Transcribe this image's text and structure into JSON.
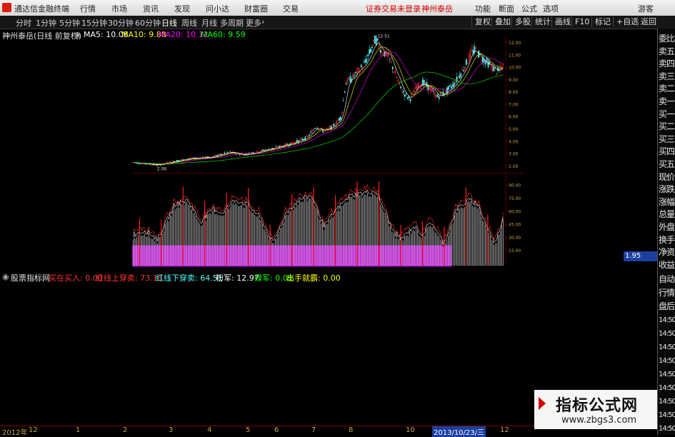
{
  "menubar": {
    "app_name": "通达信金融终端",
    "items": [
      "行情",
      "市场",
      "资讯",
      "发现",
      "问小达",
      "财富圈",
      "交易"
    ],
    "warning": "证券交易未登录",
    "stock_tag": "神州泰岳",
    "right_items": [
      "功能",
      "断面",
      "公式",
      "选项"
    ],
    "guest": "游客"
  },
  "toolbar": {
    "periods": [
      "分时",
      "1分钟",
      "5分钟",
      "15分钟",
      "30分钟",
      "60分钟",
      "日线",
      "周线",
      "月线",
      "多周期",
      "更多"
    ],
    "active_period": "日线",
    "right_buttons": [
      "复权",
      "叠加",
      "多股",
      "统计",
      "画线",
      "F10",
      "标记",
      "+自选",
      "返回"
    ]
  },
  "main_chart": {
    "title": "神州泰岳(日线 前复权)",
    "ma5": "MA5: 10.08",
    "ma10": "MA10: 9.88",
    "ma20": "MA20: 10.12",
    "ma60": "MA60: 9.59",
    "high_label": "12.51",
    "low_label": "2.06",
    "current_price_tag": "1.95",
    "y_ticks": [
      "12.00",
      "11.00",
      "10.00",
      "9.00",
      "8.00",
      "7.00",
      "6.00",
      "5.00",
      "4.00",
      "3.00",
      "2.00"
    ],
    "colors": {
      "ma5": "#ffffff",
      "ma10": "#ffff00",
      "ma20": "#ff00ff",
      "ma60": "#00ff00",
      "up": "#ff3232",
      "down": "#54fcfc"
    }
  },
  "indicator": {
    "name": "股票指标网",
    "fields": [
      {
        "label": "买在买入: 0.00",
        "color": "#ff3232"
      },
      {
        "label": "红线上穿卖: 73.18",
        "color": "#ff3232"
      },
      {
        "label": "红线下穿卖: 64.51",
        "color": "#54fcfc"
      },
      {
        "label": "粉军: 12.97",
        "color": "#ffffff"
      },
      {
        "label": "绿军: 0.00",
        "color": "#00ff00"
      },
      {
        "label": "出手就霸: 0.00",
        "color": "#ffff00"
      }
    ],
    "y_ticks": [
      "90.00",
      "75.00",
      "60.00",
      "45.00",
      "30.00",
      "15.00"
    ]
  },
  "sidebar": {
    "top_items": [
      "委比",
      "卖五",
      "卖四",
      "卖三",
      "卖二",
      "卖一",
      "买一",
      "买二",
      "买三",
      "买四",
      "买五",
      "现价",
      "涨跌",
      "涨幅",
      "总量",
      "外盘",
      "换手",
      "净资",
      "收益"
    ],
    "bottom_items": [
      "自动",
      "行情",
      "盘后",
      "14:50",
      "14:50",
      "14:50",
      "14:50",
      "14:50",
      "14:50",
      "14:50",
      "14:50",
      "14:50"
    ]
  },
  "date_axis": {
    "labels": [
      "2012年",
      "12",
      "1",
      "2",
      "3",
      "4",
      "5",
      "6",
      "7",
      "8",
      "10",
      "2013/10/23/三",
      "12"
    ]
  },
  "watermark": {
    "line1": "指标公式网",
    "line2": "www.zbgs3.com"
  }
}
